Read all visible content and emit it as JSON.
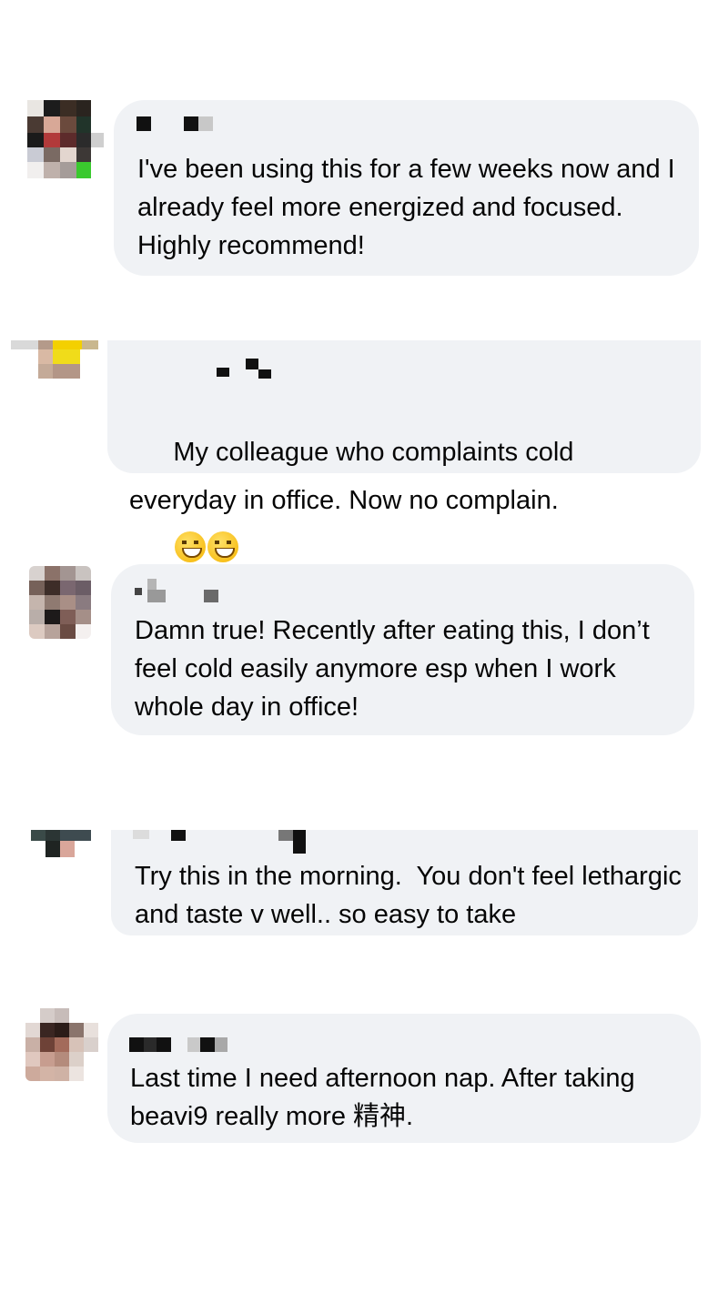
{
  "comments": [
    {
      "text": "I've been using this for a few weeks now and I already feel more energized and focused. Highly recommend!"
    },
    {
      "text": "My colleague who complaints cold everyday in office. Now no complain.",
      "emojis": [
        "grinning-face-with-smiling-eyes",
        "grinning-squinting-face"
      ]
    },
    {
      "text": "Damn true! Recently after eating this, I don’t feel cold easily anymore esp when I work whole day in office!"
    },
    {
      "text": "Try this in the morning.  You don't feel lethargic and taste v well.. so easy to take"
    },
    {
      "text": "Last time I need afternoon nap. After taking beavi9 really more 精神."
    }
  ]
}
